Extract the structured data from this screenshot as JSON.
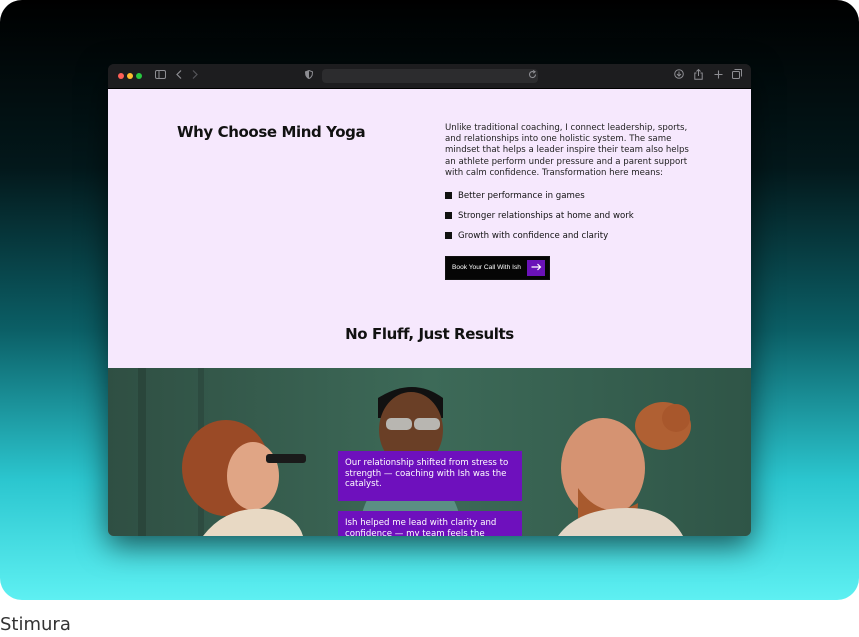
{
  "browser": {
    "traffic_lights": [
      {
        "name": "close",
        "color": "#ff5f57"
      },
      {
        "name": "minimize",
        "color": "#febc2e"
      },
      {
        "name": "zoom",
        "color": "#28c840"
      }
    ],
    "icons": [
      "sidebar-icon",
      "back-icon",
      "forward-icon",
      "shield-icon",
      "reload-icon",
      "download-icon",
      "share-icon",
      "new-tab-icon",
      "tabs-overview-icon"
    ],
    "address_value": ""
  },
  "why": {
    "title_light": "Why Choose ",
    "title_bold": "Mind Yoga",
    "intro": "Unlike traditional coaching, I connect leadership, sports, and relationships into one holistic system. The same mindset that helps a leader inspire their team also helps an athlete perform under pressure and a parent support with calm confidence. Transformation here means:",
    "benefits": [
      "Better performance in games",
      "Stronger relationships at home and work",
      "Growth with confidence and clarity"
    ],
    "cta_label": "Book Your Call With Ish",
    "cta_icon": "arrow-right-icon"
  },
  "results": {
    "title_light": "No Fluff, Just ",
    "title_bold": "Results"
  },
  "testimonials": [
    "Our relationship shifted from stress to strength — coaching with Ish was the catalyst.",
    "Ish helped me lead with clarity and confidence — my team feels the difference."
  ],
  "colors": {
    "page_bg": "#f6e8fd",
    "accent": "#6e10bd",
    "cta_bg": "#050505"
  },
  "caption": "Stimura"
}
